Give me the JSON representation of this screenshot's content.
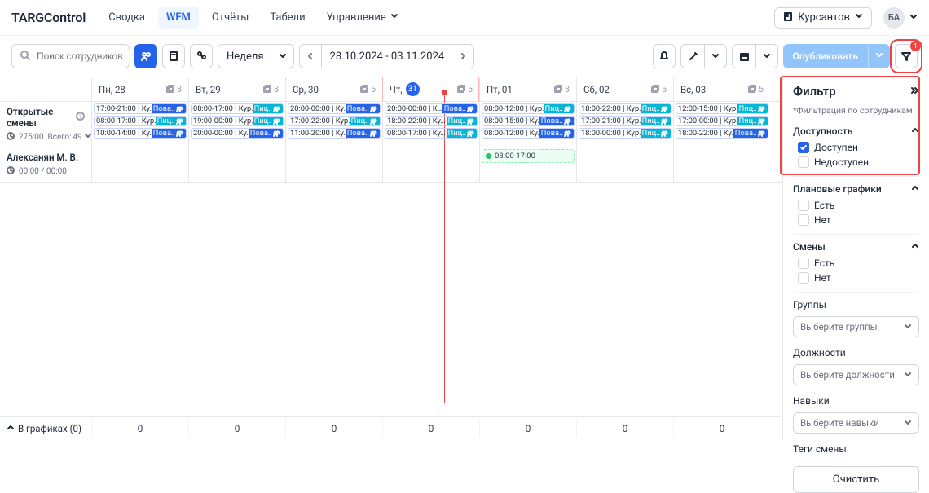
{
  "brand": "TARGControl",
  "nav": {
    "summary": "Сводка",
    "wfm": "WFM",
    "reports": "Отчёты",
    "timesheets": "Табели",
    "manage": "Управление"
  },
  "header": {
    "org": "Курсантов",
    "avatar": "БА",
    "filter_badge": "1"
  },
  "toolbar": {
    "search_placeholder": "Поиск сотрудников",
    "period": "Неделя",
    "range": "28.10.2024 - 03.11.2024",
    "publish": "Опубликовать"
  },
  "days": [
    {
      "label": "Пн, 28",
      "copies": "8"
    },
    {
      "label": "Вт, 29",
      "copies": "8"
    },
    {
      "label": "Ср, 30",
      "copies": "5"
    },
    {
      "label_pre": "Чт,",
      "badge_day": "31",
      "copies": "5"
    },
    {
      "label": "Пт, 01",
      "copies": "8"
    },
    {
      "label": "Сб, 02",
      "copies": "5"
    },
    {
      "label": "Вс, 03",
      "copies": "5"
    }
  ],
  "open_shifts": {
    "title": "Открытые смены",
    "hours": "275:00",
    "total_label": "Всего:",
    "total_value": "49"
  },
  "shifts": [
    [
      {
        "time": "17:00-21:00 | Ку…",
        "tag": "Пова..",
        "c": "blue"
      },
      {
        "time": "08:00-17:00 | Кур…",
        "tag": "Пиц..",
        "c": "cyan"
      },
      {
        "time": "10:00-14:00 | Ку…",
        "tag": "Пова..",
        "c": "blue"
      }
    ],
    [
      {
        "time": "08:00-17:00 | Кур…",
        "tag": "Пиц..",
        "c": "cyan"
      },
      {
        "time": "19:00-00:00 | Кур…",
        "tag": "Пиц..",
        "c": "cyan"
      },
      {
        "time": "20:00-00:00 | Ку…",
        "tag": "Пова..",
        "c": "blue"
      }
    ],
    [
      {
        "time": "20:00-00:00 | Ку…",
        "tag": "Пова..",
        "c": "blue"
      },
      {
        "time": "17:00-22:00 | Кур…",
        "tag": "Пиц..",
        "c": "cyan"
      },
      {
        "time": "11:00-20:00 | Ку…",
        "tag": "Пова..",
        "c": "blue"
      }
    ],
    [
      {
        "time": "20:00-00:00 | К…",
        "tag": "Пова..",
        "c": "blue"
      },
      {
        "time": "18:00-22:00 | Ку…",
        "tag": "Пиц..",
        "c": "cyan"
      },
      {
        "time": "08:00-17:00 | Ку…",
        "tag": "Пиц..",
        "c": "cyan"
      }
    ],
    [
      {
        "time": "08:00-12:00 | Кур…",
        "tag": "Пиц..",
        "c": "cyan"
      },
      {
        "time": "08:00-15:00 | Ку…",
        "tag": "Пова..",
        "c": "blue"
      },
      {
        "time": "08:00-12:00 | Ку…",
        "tag": "Пова..",
        "c": "blue"
      }
    ],
    [
      {
        "time": "18:00-22:00 | Кур…",
        "tag": "Пиц..",
        "c": "cyan"
      },
      {
        "time": "17:00-21:00 | Кур…",
        "tag": "Пиц..",
        "c": "cyan"
      },
      {
        "time": "18:00-00:00 | Кур…",
        "tag": "Пиц..",
        "c": "cyan"
      }
    ],
    [
      {
        "time": "12:00-15:00 | Кур…",
        "tag": "Пиц..",
        "c": "cyan"
      },
      {
        "time": "17:00-00:00 | Кур…",
        "tag": "Пиц..",
        "c": "cyan"
      },
      {
        "time": "18:00-22:00 | Ку…",
        "tag": "Пова..",
        "c": "blue"
      }
    ]
  ],
  "employee": {
    "name": "Алексанян М. В.",
    "hours": "00:00 / 00:00",
    "avail": "08:00-17:00"
  },
  "filter": {
    "title": "Фильтр",
    "note": "*Фильтрация по сотрудникам",
    "availability": {
      "label": "Доступность",
      "available": "Доступен",
      "unavailable": "Недоступен"
    },
    "plans": {
      "label": "Плановые графики",
      "yes": "Есть",
      "no": "Нет"
    },
    "shifts": {
      "label": "Смены",
      "yes": "Есть",
      "no": "Нет"
    },
    "groups": {
      "label": "Группы",
      "placeholder": "Выберите группы"
    },
    "positions": {
      "label": "Должности",
      "placeholder": "Выберите должности"
    },
    "skills": {
      "label": "Навыки",
      "placeholder": "Выберите навыки"
    },
    "shift_tags": {
      "label": "Теги смены"
    },
    "clear": "Очистить"
  },
  "footer": {
    "label": "В графиках (0)",
    "vals": [
      "0",
      "0",
      "0",
      "0",
      "0",
      "0",
      "0"
    ]
  }
}
